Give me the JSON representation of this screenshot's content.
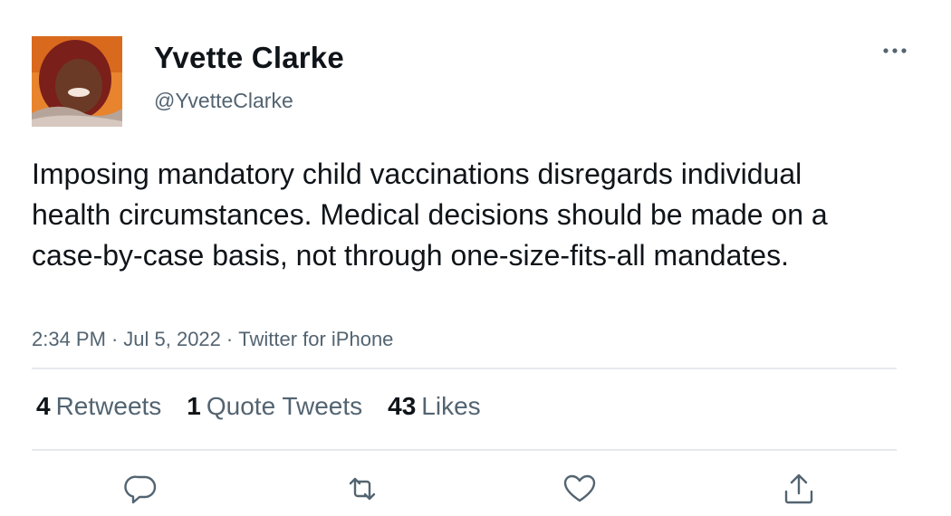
{
  "author": {
    "display_name": "Yvette Clarke",
    "handle": "@YvetteClarke"
  },
  "tweet": {
    "text": "Imposing mandatory child vaccinations disregards individual health circumstances. Medical decisions should be made on a case-by-case basis, not through one-size-fits-all mandates.",
    "time": "2:34 PM",
    "date": "Jul 5, 2022",
    "source": "Twitter for iPhone",
    "separator": "·"
  },
  "stats": {
    "retweets": {
      "count": "4",
      "label": "Retweets"
    },
    "quotes": {
      "count": "1",
      "label": "Quote Tweets"
    },
    "likes": {
      "count": "43",
      "label": "Likes"
    }
  },
  "actions": {
    "reply": "reply-icon",
    "retweet": "retweet-icon",
    "like": "heart-icon",
    "share": "share-icon"
  },
  "colors": {
    "text_primary": "#0f1419",
    "text_secondary": "#536471",
    "divider": "#e6e9ec",
    "icon": "#536471"
  }
}
